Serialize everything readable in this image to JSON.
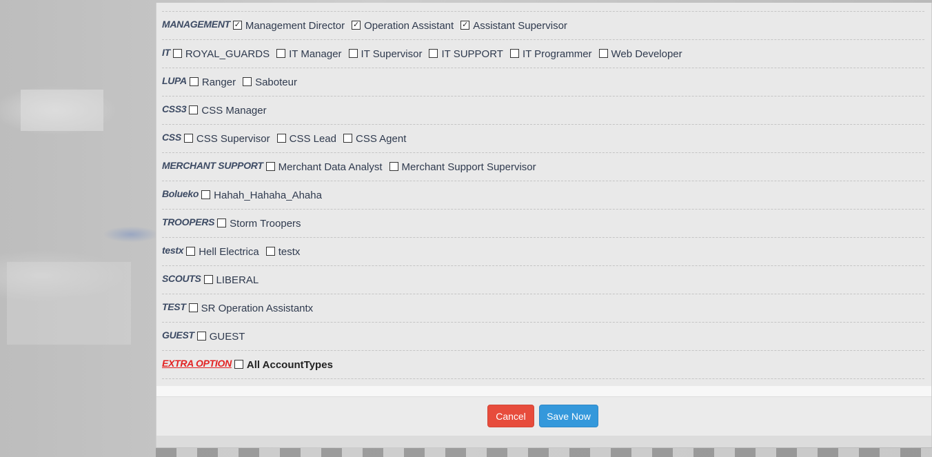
{
  "groups": [
    {
      "label": "MANAGEMENT",
      "options": [
        {
          "label": "Management Director",
          "checked": true
        },
        {
          "label": "Operation Assistant",
          "checked": true
        },
        {
          "label": "Assistant Supervisor",
          "checked": true
        }
      ]
    },
    {
      "label": "IT",
      "options": [
        {
          "label": "ROYAL_GUARDS",
          "checked": false
        },
        {
          "label": "IT Manager",
          "checked": false
        },
        {
          "label": "IT Supervisor",
          "checked": false
        },
        {
          "label": "IT SUPPORT",
          "checked": false
        },
        {
          "label": "IT Programmer",
          "checked": false
        },
        {
          "label": "Web Developer",
          "checked": false
        }
      ]
    },
    {
      "label": "LUPA",
      "options": [
        {
          "label": "Ranger",
          "checked": false
        },
        {
          "label": "Saboteur",
          "checked": false
        }
      ]
    },
    {
      "label": "CSS3",
      "options": [
        {
          "label": "CSS Manager",
          "checked": false
        }
      ]
    },
    {
      "label": "CSS",
      "options": [
        {
          "label": "CSS Supervisor",
          "checked": false
        },
        {
          "label": "CSS Lead",
          "checked": false
        },
        {
          "label": "CSS Agent",
          "checked": false
        }
      ]
    },
    {
      "label": "MERCHANT SUPPORT",
      "options": [
        {
          "label": "Merchant Data Analyst",
          "checked": false
        },
        {
          "label": "Merchant Support Supervisor",
          "checked": false
        }
      ]
    },
    {
      "label": "Bolueko",
      "options": [
        {
          "label": "Hahah_Hahaha_Ahaha",
          "checked": false
        }
      ]
    },
    {
      "label": "TROOPERS",
      "options": [
        {
          "label": "Storm Troopers",
          "checked": false
        }
      ]
    },
    {
      "label": "testx",
      "options": [
        {
          "label": "Hell Electrica",
          "checked": false
        },
        {
          "label": "testx",
          "checked": false
        }
      ]
    },
    {
      "label": "SCOUTS",
      "options": [
        {
          "label": "LIBERAL",
          "checked": false
        }
      ]
    },
    {
      "label": "TEST",
      "options": [
        {
          "label": "SR Operation Assistantx",
          "checked": false
        }
      ]
    },
    {
      "label": "GUEST",
      "options": [
        {
          "label": "GUEST",
          "checked": false
        }
      ]
    }
  ],
  "extra_option": {
    "label": "EXTRA OPTION",
    "option_label": "All AccountTypes",
    "checked": false
  },
  "footer": {
    "cancel_label": "Cancel",
    "save_label": "Save Now"
  },
  "colors": {
    "cancel": "#e74c3c",
    "save": "#3498db",
    "extra_label": "#e32222",
    "group_label": "#3c4a63"
  }
}
